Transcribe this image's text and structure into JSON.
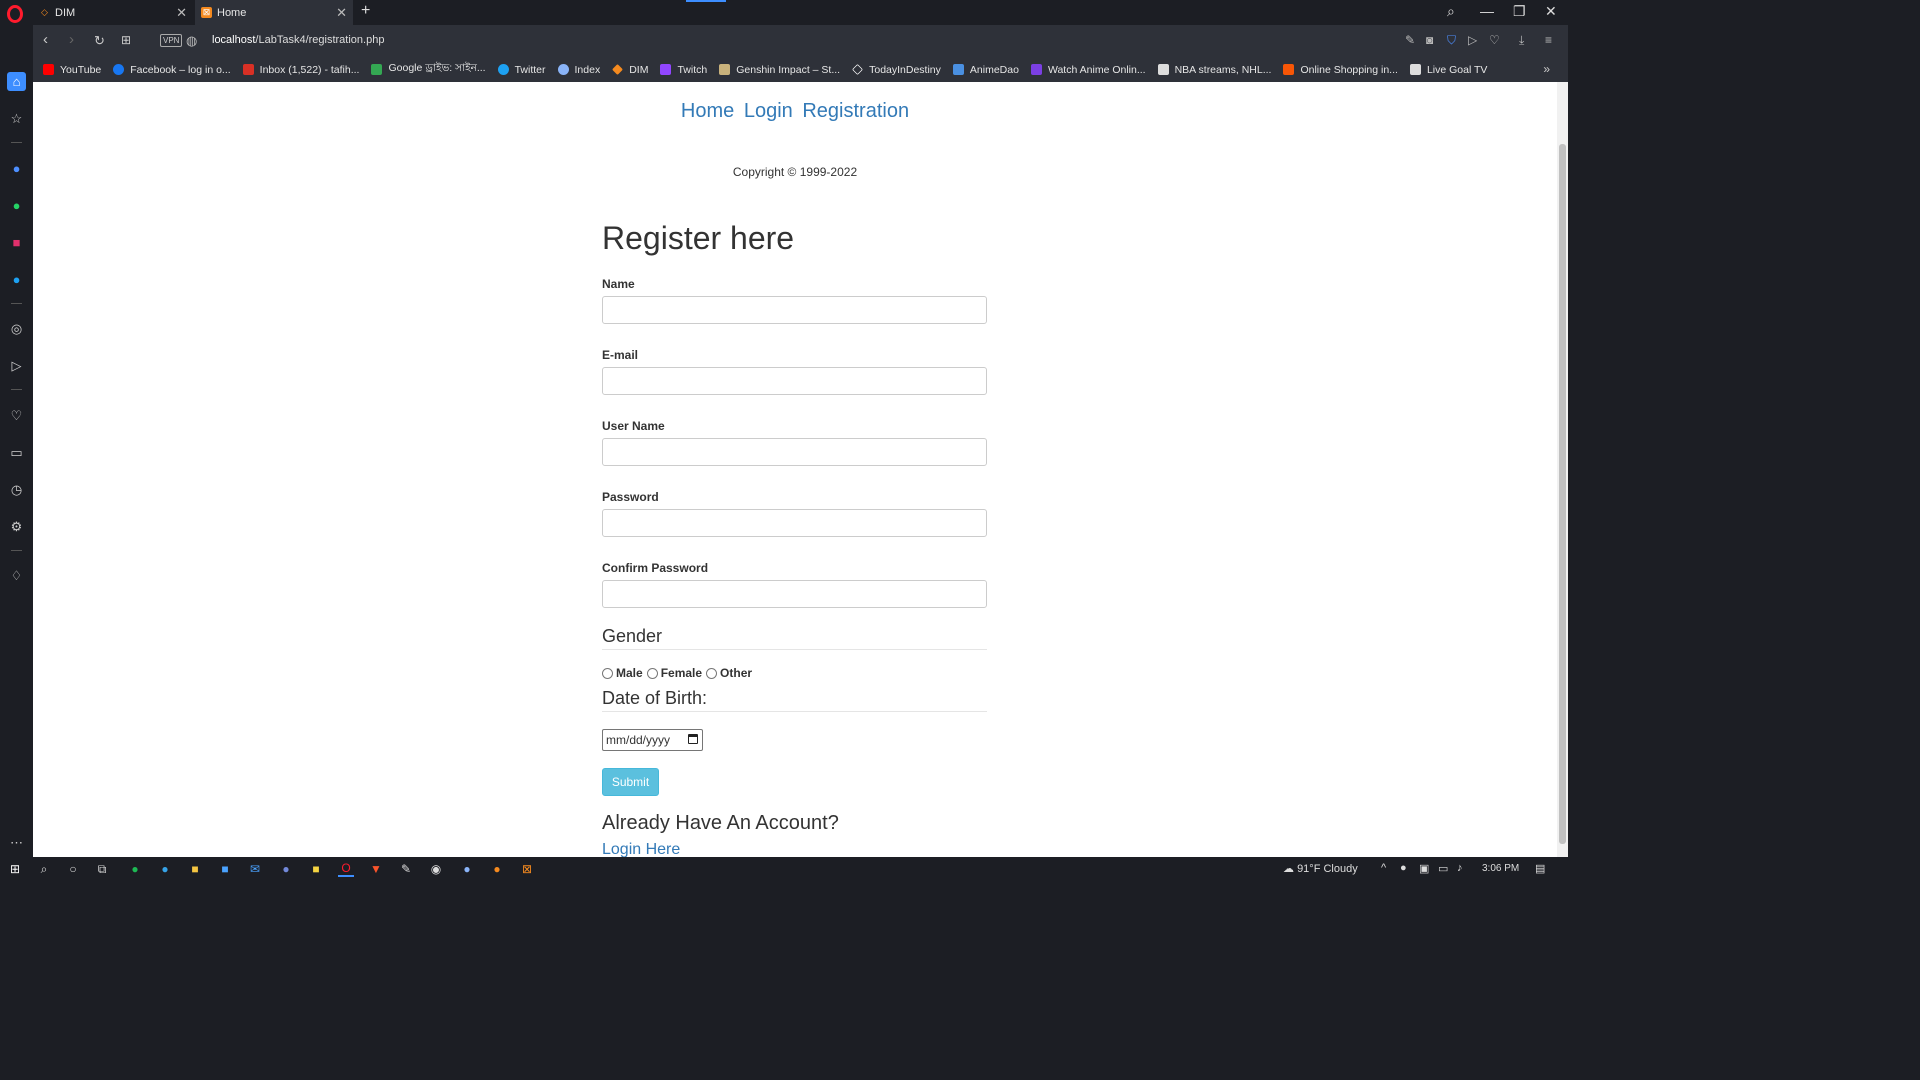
{
  "browser": {
    "tabs": [
      {
        "title": "DIM",
        "active": false,
        "favicon": "dim-diamond-icon"
      },
      {
        "title": "Home",
        "active": true,
        "favicon": "xampp-icon"
      }
    ],
    "url_host": "localhost",
    "url_path": "/LabTask4/registration.php",
    "vpn_label": "VPN",
    "bookmarks": [
      {
        "label": "YouTube",
        "color": "#ff0000"
      },
      {
        "label": "Facebook – log in o...",
        "color": "#1877f2"
      },
      {
        "label": "Inbox (1,522) - tafih...",
        "color": "#d93025"
      },
      {
        "label": "Google ড্রাইভ: সাইন...",
        "color": "#34a853"
      },
      {
        "label": "Twitter",
        "color": "#1da1f2"
      },
      {
        "label": "Index",
        "color": "#8ab4f8"
      },
      {
        "label": "DIM",
        "color": "#f58a1f"
      },
      {
        "label": "Twitch",
        "color": "#9146ff"
      },
      {
        "label": "Genshin Impact – St...",
        "color": "#c9b27c"
      },
      {
        "label": "TodayInDestiny",
        "color": "#ffffff"
      },
      {
        "label": "AnimeDao",
        "color": "#4a90e2"
      },
      {
        "label": "Watch Anime Onlin...",
        "color": "#7b3fe4"
      },
      {
        "label": "NBA streams, NHL...",
        "color": "#dddddd"
      },
      {
        "label": "Online Shopping in...",
        "color": "#f85606"
      },
      {
        "label": "Live Goal TV",
        "color": "#dddddd"
      }
    ]
  },
  "page": {
    "nav": [
      "Home",
      "Login",
      "Registration"
    ],
    "copyright": "Copyright © 1999-2022",
    "heading": "Register here",
    "fields": {
      "name": "Name",
      "email": "E-mail",
      "username": "User Name",
      "password": "Password",
      "confirm_password": "Confirm Password"
    },
    "gender_legend": "Gender",
    "genders": [
      "Male",
      "Female",
      "Other"
    ],
    "dob_legend": "Date of Birth:",
    "dob_placeholder": "mm/dd/yyyy",
    "submit_label": "Submit",
    "already_text": "Already Have An Account?",
    "login_link": "Login Here"
  },
  "taskbar": {
    "weather": "91°F  Cloudy",
    "time": "3:06 PM"
  },
  "colors": {
    "link": "#337ab7",
    "submit": "#5bc0de",
    "accent": "#3d8eff"
  }
}
